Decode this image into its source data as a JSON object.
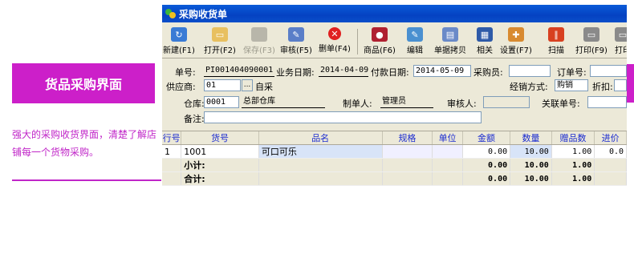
{
  "promo": {
    "title": "货品采购界面",
    "desc": "强大的采购收货界面，清楚了解店铺每一个货物采购。"
  },
  "window": {
    "title": "采购收货单"
  },
  "toolbar": {
    "new": "新建(F1)",
    "open": "打开(F2)",
    "save": "保存(F3)",
    "audit": "审核(F5)",
    "delete": "删单(F4)",
    "goods": "商品(F6)",
    "edit": "编辑",
    "copy": "单据拷贝",
    "related": "相关",
    "settings": "设置(F7)",
    "scan": "扫描",
    "print": "打印(F9)",
    "print2": "打印"
  },
  "form": {
    "order_no_label": "单号:",
    "order_no": "PI001404090001",
    "biz_date_label": "业务日期:",
    "biz_date": "2014-04-09",
    "pay_date_label": "付款日期:",
    "pay_date": "2014-05-09",
    "buyer_label": "采购员:",
    "buyer": "",
    "orderno_label": "订单号:",
    "orderno": "",
    "supplier_label": "供应商:",
    "supplier_code": "01",
    "supplier_btn": "...",
    "supplier_name": "自采",
    "mode_label": "经销方式:",
    "mode": "购销",
    "discount_label": "折扣:",
    "discount": "",
    "warehouse_label": "仓库:",
    "warehouse_code": "0001",
    "warehouse_name": "总部仓库",
    "maker_label": "制单人:",
    "maker": "管理员",
    "auditor_label": "审核人:",
    "auditor": "",
    "link_label": "关联单号:",
    "link": "",
    "remark_label": "备注:",
    "remark": ""
  },
  "grid": {
    "columns": [
      "行号",
      "货号",
      "品名",
      "规格",
      "单位",
      "金额",
      "数量",
      "赠品数",
      "进价"
    ],
    "rows": [
      [
        "1",
        "1001",
        "可口可乐",
        "",
        "",
        "0.00",
        "10.00",
        "1.00",
        "0.0"
      ]
    ],
    "subtotal": {
      "label": "小计:",
      "amount": "0.00",
      "qty": "10.00",
      "gift": "1.00"
    },
    "total": {
      "label": "合计:",
      "amount": "0.00",
      "qty": "10.00",
      "gift": "1.00"
    }
  }
}
